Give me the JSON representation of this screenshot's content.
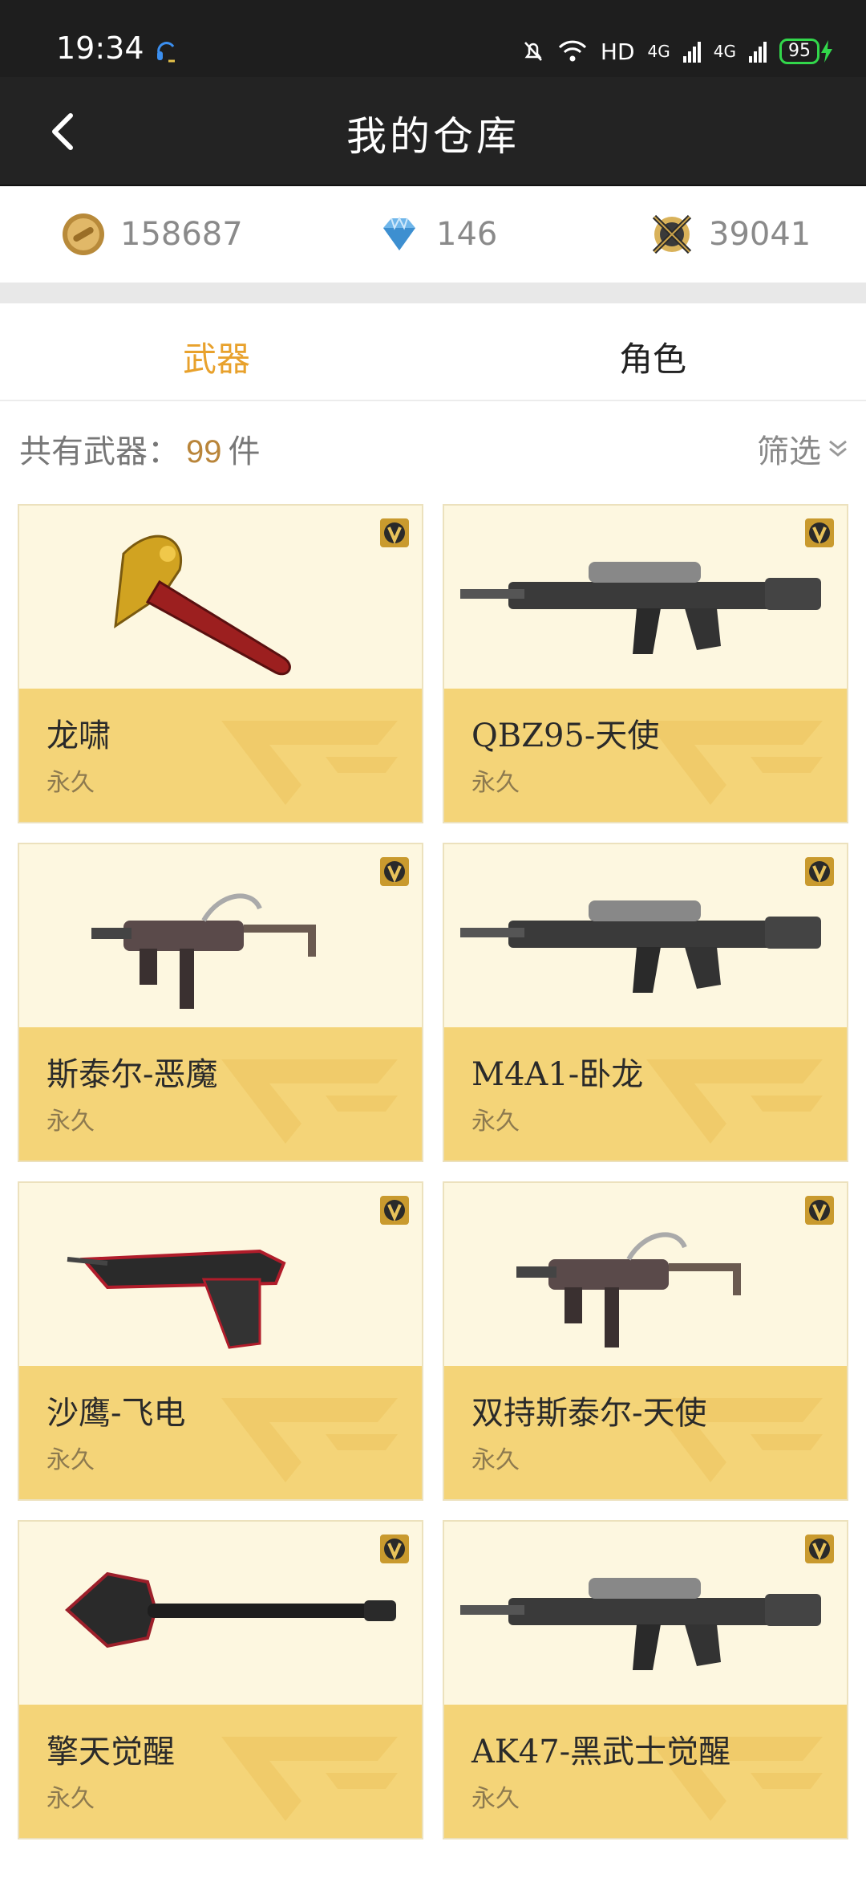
{
  "status_bar": {
    "time": "19:34",
    "network": "HD",
    "signal1": "4G",
    "signal2": "4G",
    "battery": "95"
  },
  "nav": {
    "title": "我的仓库"
  },
  "currency": {
    "gold": "158687",
    "diamond": "146",
    "medal": "39041"
  },
  "tabs": [
    {
      "label": "武器",
      "active": true
    },
    {
      "label": "角色",
      "active": false
    }
  ],
  "summary": {
    "prefix": "共有武器：",
    "count": "99",
    "suffix": "件",
    "filter_label": "筛选"
  },
  "items": [
    {
      "name": "龙啸",
      "duration": "永久",
      "icon": "dragon-axe-icon"
    },
    {
      "name": "QBZ95-天使",
      "duration": "永久",
      "icon": "rifle-icon"
    },
    {
      "name": "斯泰尔-恶魔",
      "duration": "永久",
      "icon": "smg-icon"
    },
    {
      "name": "M4A1-卧龙",
      "duration": "永久",
      "icon": "rifle-icon"
    },
    {
      "name": "沙鹰-飞电",
      "duration": "永久",
      "icon": "pistol-icon"
    },
    {
      "name": "双持斯泰尔-天使",
      "duration": "永久",
      "icon": "smg-icon"
    },
    {
      "name": "擎天觉醒",
      "duration": "永久",
      "icon": "shovel-icon"
    },
    {
      "name": "AK47-黑武士觉醒",
      "duration": "永久",
      "icon": "rifle-icon"
    }
  ],
  "colors": {
    "accent": "#e8a12c",
    "card_bottom": "#f4d478",
    "card_top": "#fdf7e0"
  }
}
